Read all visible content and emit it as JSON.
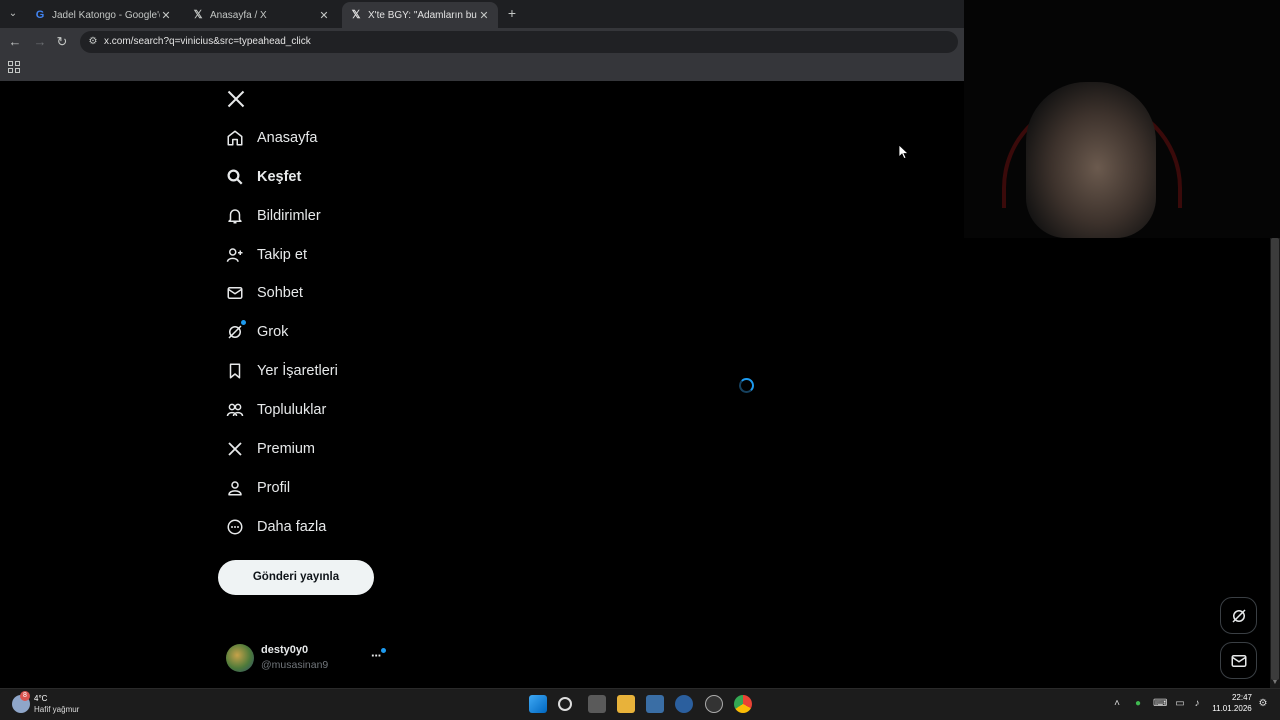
{
  "browser": {
    "tabs": [
      {
        "label": "Jadel Katongo - Google'da Ara",
        "favicon": "google-icon",
        "active": false
      },
      {
        "label": "Anasayfa / X",
        "favicon": "x-icon",
        "active": false
      },
      {
        "label": "X'te BGY: \"Adamların bu kadar",
        "favicon": "x-icon",
        "active": true
      }
    ],
    "url": "x.com/search?q=vinicius&src=typeahead_click"
  },
  "sidebar": {
    "items": [
      {
        "label": "Anasayfa",
        "icon": "home-icon"
      },
      {
        "label": "Keşfet",
        "icon": "search-icon"
      },
      {
        "label": "Bildirimler",
        "icon": "bell-icon"
      },
      {
        "label": "Takip et",
        "icon": "follow-icon"
      },
      {
        "label": "Sohbet",
        "icon": "mail-icon"
      },
      {
        "label": "Grok",
        "icon": "grok-icon"
      },
      {
        "label": "Yer İşaretleri",
        "icon": "bookmark-icon"
      },
      {
        "label": "Topluluklar",
        "icon": "communities-icon"
      },
      {
        "label": "Premium",
        "icon": "x-premium-icon"
      },
      {
        "label": "Profil",
        "icon": "profile-icon"
      },
      {
        "label": "Daha fazla",
        "icon": "more-icon"
      }
    ],
    "active_item": "Keşfet",
    "post_button": "Gönderi yayınla"
  },
  "account": {
    "display_name": "desty0y0",
    "handle": "@musasinan9"
  },
  "taskbar": {
    "weather_temp": "4°C",
    "weather_desc": "Hafif yağmur",
    "weather_badge": "8",
    "time": "22:47",
    "date": "11.01.2026"
  },
  "colors": {
    "accent": "#1d9bf0",
    "background": "#000000",
    "text": "#e7e9ea",
    "post_button_bg": "#eff3f4"
  }
}
